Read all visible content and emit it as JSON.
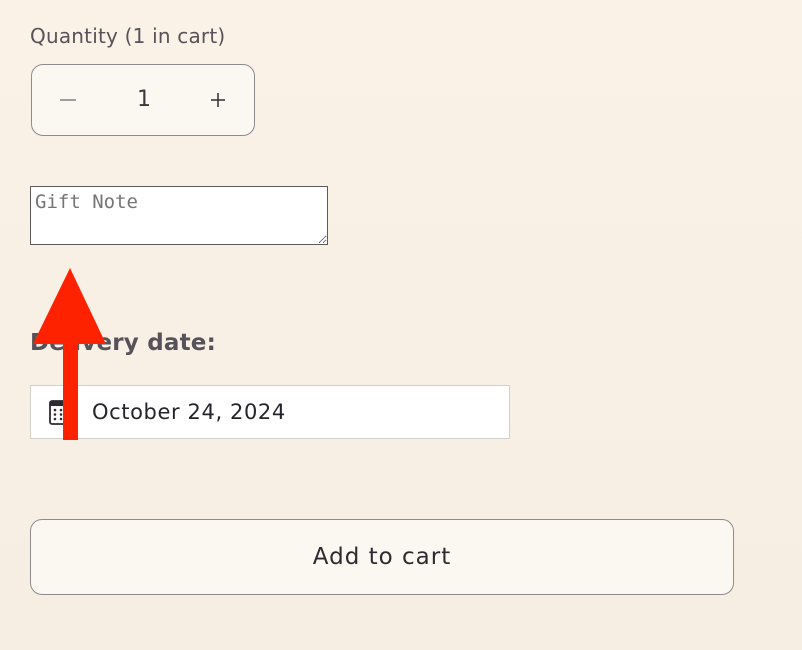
{
  "quantity": {
    "label": "Quantity (1 in cart)",
    "value": "1",
    "decrement_icon": "minus-icon",
    "increment_icon": "plus-icon"
  },
  "gift_note": {
    "placeholder": "Gift Note",
    "value": ""
  },
  "delivery": {
    "label": "Delivery date:",
    "date_value": "October 24, 2024",
    "icon": "calendar-icon"
  },
  "cart": {
    "add_label": "Add to cart"
  },
  "annotation": {
    "type": "arrow-up",
    "color": "#ff2200"
  },
  "colors": {
    "background": "#f8f0e4",
    "button_border": "#8e8a8e",
    "text": "#3b3840"
  }
}
